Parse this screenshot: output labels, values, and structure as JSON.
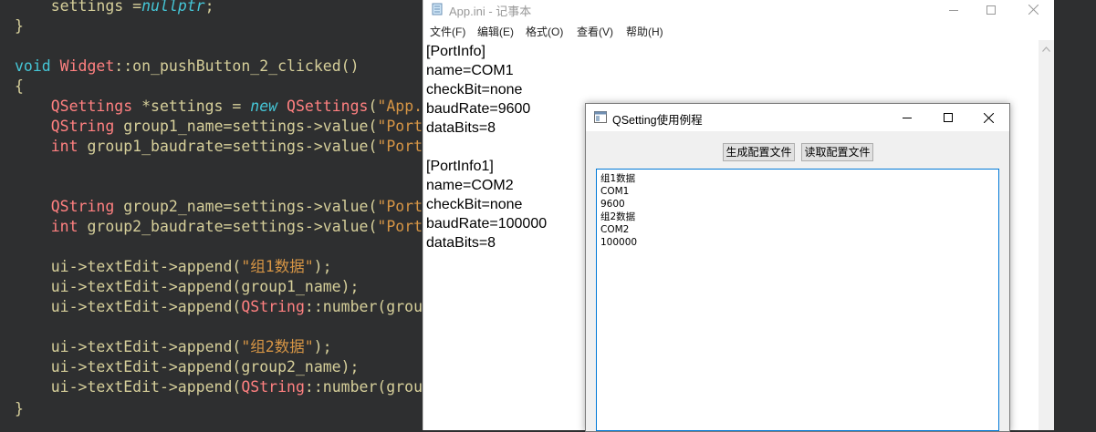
{
  "editor": {
    "lines": [
      [
        {
          "t": "    settings =",
          "c": "t-default"
        },
        {
          "t": "nullptr",
          "c": "t-kw-italic"
        },
        {
          "t": ";",
          "c": "t-default"
        }
      ],
      [
        {
          "t": "}",
          "c": "t-default"
        }
      ],
      [],
      [
        {
          "t": "void ",
          "c": "t-kw"
        },
        {
          "t": "Widget",
          "c": "t-type"
        },
        {
          "t": "::",
          "c": "t-default"
        },
        {
          "t": "on_pushButton_2_clicked",
          "c": "t-default"
        },
        {
          "t": "()",
          "c": "t-default"
        }
      ],
      [
        {
          "t": "{",
          "c": "t-default"
        }
      ],
      [
        {
          "t": "    ",
          "c": "t-default"
        },
        {
          "t": "QSettings",
          "c": "t-type"
        },
        {
          "t": " *settings = ",
          "c": "t-default"
        },
        {
          "t": "new ",
          "c": "t-kw-italic"
        },
        {
          "t": "QSettings",
          "c": "t-type"
        },
        {
          "t": "(",
          "c": "t-default"
        },
        {
          "t": "\"App.i",
          "c": "t-string"
        }
      ],
      [
        {
          "t": "    ",
          "c": "t-default"
        },
        {
          "t": "QString",
          "c": "t-type"
        },
        {
          "t": " group1_name=settings->value(",
          "c": "t-default"
        },
        {
          "t": "\"PortI",
          "c": "t-string"
        }
      ],
      [
        {
          "t": "    ",
          "c": "t-default"
        },
        {
          "t": "int",
          "c": "t-type"
        },
        {
          "t": " group1_baudrate=settings->value(",
          "c": "t-default"
        },
        {
          "t": "\"PortI",
          "c": "t-string"
        }
      ],
      [],
      [],
      [
        {
          "t": "    ",
          "c": "t-default"
        },
        {
          "t": "QString",
          "c": "t-type"
        },
        {
          "t": " group2_name=settings->value(",
          "c": "t-default"
        },
        {
          "t": "\"PortI",
          "c": "t-string"
        }
      ],
      [
        {
          "t": "    ",
          "c": "t-default"
        },
        {
          "t": "int",
          "c": "t-type"
        },
        {
          "t": " group2_baudrate=settings->value(",
          "c": "t-default"
        },
        {
          "t": "\"PortI",
          "c": "t-string"
        }
      ],
      [],
      [
        {
          "t": "    ui->textEdit->append(",
          "c": "t-default"
        },
        {
          "t": "\"组1数据\"",
          "c": "t-string"
        },
        {
          "t": ");",
          "c": "t-default"
        }
      ],
      [
        {
          "t": "    ui->textEdit->append(group1_name);",
          "c": "t-default"
        }
      ],
      [
        {
          "t": "    ui->textEdit->append(",
          "c": "t-default"
        },
        {
          "t": "QString",
          "c": "t-type"
        },
        {
          "t": "::number(group",
          "c": "t-default"
        }
      ],
      [],
      [
        {
          "t": "    ui->textEdit->append(",
          "c": "t-default"
        },
        {
          "t": "\"组2数据\"",
          "c": "t-string"
        },
        {
          "t": ");",
          "c": "t-default"
        }
      ],
      [
        {
          "t": "    ui->textEdit->append(group2_name);",
          "c": "t-default"
        }
      ],
      [
        {
          "t": "    ui->textEdit->append(",
          "c": "t-default"
        },
        {
          "t": "QString",
          "c": "t-type"
        },
        {
          "t": "::number(group",
          "c": "t-default"
        }
      ],
      [
        {
          "t": "}",
          "c": "t-default"
        }
      ]
    ]
  },
  "notepad": {
    "title": "App.ini - 记事本",
    "menu": [
      "文件(F)",
      "编辑(E)",
      "格式(O)",
      "查看(V)",
      "帮助(H)"
    ],
    "lines": [
      "[PortInfo]",
      "name=COM1",
      "checkBit=none",
      "baudRate=9600",
      "dataBits=8",
      "",
      "[PortInfo1]",
      "name=COM2",
      "checkBit=none",
      "baudRate=100000",
      "dataBits=8"
    ]
  },
  "dialog": {
    "title": "QSetting使用例程",
    "buttons": {
      "generate": "生成配置文件",
      "read": "读取配置文件"
    },
    "textedit_lines": [
      "组1数据",
      "COM1",
      "9600",
      "组2数据",
      "COM2",
      "100000"
    ]
  }
}
